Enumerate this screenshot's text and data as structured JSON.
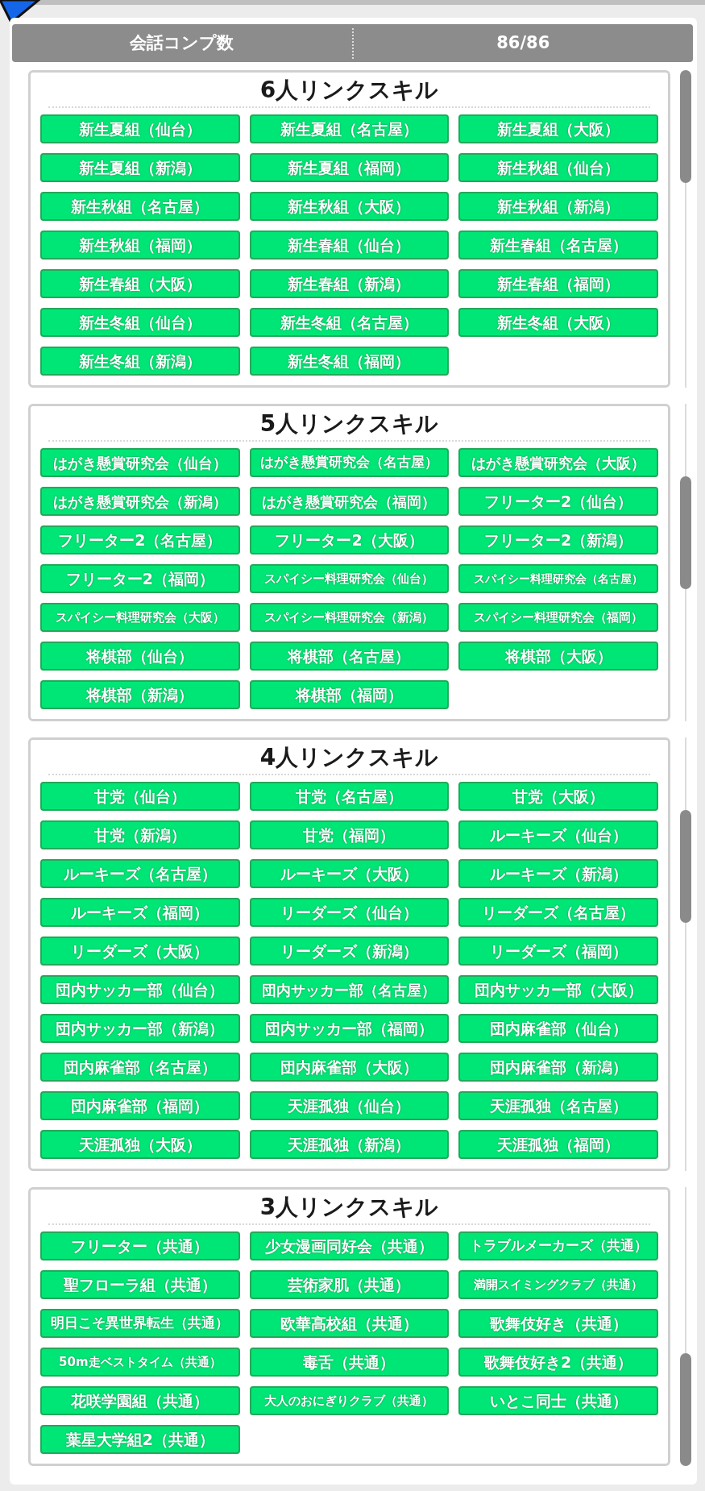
{
  "summary": {
    "label": "会話コンプ数",
    "value": "86/86"
  },
  "sections": [
    {
      "title": "6人リンクスキル",
      "items": [
        "新生夏組（仙台）",
        "新生夏組（名古屋）",
        "新生夏組（大阪）",
        "新生夏組（新潟）",
        "新生夏組（福岡）",
        "新生秋組（仙台）",
        "新生秋組（名古屋）",
        "新生秋組（大阪）",
        "新生秋組（新潟）",
        "新生秋組（福岡）",
        "新生春組（仙台）",
        "新生春組（名古屋）",
        "新生春組（大阪）",
        "新生春組（新潟）",
        "新生春組（福岡）",
        "新生冬組（仙台）",
        "新生冬組（名古屋）",
        "新生冬組（大阪）",
        "新生冬組（新潟）",
        "新生冬組（福岡）"
      ]
    },
    {
      "title": "5人リンクスキル",
      "items": [
        "はがき懸賞研究会（仙台）",
        "はがき懸賞研究会（名古屋）",
        "はがき懸賞研究会（大阪）",
        "はがき懸賞研究会（新潟）",
        "はがき懸賞研究会（福岡）",
        "フリーター2（仙台）",
        "フリーター2（名古屋）",
        "フリーター2（大阪）",
        "フリーター2（新潟）",
        "フリーター2（福岡）",
        "スパイシー料理研究会（仙台）",
        "スパイシー料理研究会（名古屋）",
        "スパイシー料理研究会（大阪）",
        "スパイシー料理研究会（新潟）",
        "スパイシー料理研究会（福岡）",
        "将棋部（仙台）",
        "将棋部（名古屋）",
        "将棋部（大阪）",
        "将棋部（新潟）",
        "将棋部（福岡）"
      ]
    },
    {
      "title": "4人リンクスキル",
      "items": [
        "甘党（仙台）",
        "甘党（名古屋）",
        "甘党（大阪）",
        "甘党（新潟）",
        "甘党（福岡）",
        "ルーキーズ（仙台）",
        "ルーキーズ（名古屋）",
        "ルーキーズ（大阪）",
        "ルーキーズ（新潟）",
        "ルーキーズ（福岡）",
        "リーダーズ（仙台）",
        "リーダーズ（名古屋）",
        "リーダーズ（大阪）",
        "リーダーズ（新潟）",
        "リーダーズ（福岡）",
        "団内サッカー部（仙台）",
        "団内サッカー部（名古屋）",
        "団内サッカー部（大阪）",
        "団内サッカー部（新潟）",
        "団内サッカー部（福岡）",
        "団内麻雀部（仙台）",
        "団内麻雀部（名古屋）",
        "団内麻雀部（大阪）",
        "団内麻雀部（新潟）",
        "団内麻雀部（福岡）",
        "天涯孤独（仙台）",
        "天涯孤独（名古屋）",
        "天涯孤独（大阪）",
        "天涯孤独（新潟）",
        "天涯孤独（福岡）"
      ]
    },
    {
      "title": "3人リンクスキル",
      "items": [
        "フリーター（共通）",
        "少女漫画同好会（共通）",
        "トラブルメーカーズ（共通）",
        "聖フローラ組（共通）",
        "芸術家肌（共通）",
        "満開スイミングクラブ（共通）",
        "明日こそ異世界転生（共通）",
        "欧華高校組（共通）",
        "歌舞伎好き（共通）",
        "50m走ベストタイム（共通）",
        "毒舌（共通）",
        "歌舞伎好き2（共通）",
        "花咲学園組（共通）",
        "大人のおにぎりクラブ（共通）",
        "いとこ同士（共通）",
        "葉星大学組2（共通）"
      ]
    }
  ]
}
